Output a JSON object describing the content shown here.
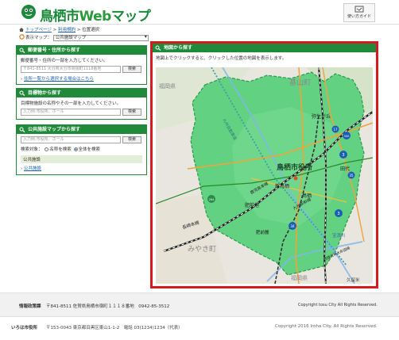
{
  "header": {
    "logo_text_city": "鳥栖市",
    "logo_text_web": "Web",
    "logo_text_map": "マップ",
    "guide_label": "使い方ガイド"
  },
  "breadcrumb": {
    "items": [
      "トップページ",
      "利用規約",
      "位置選択"
    ],
    "separators": [
      ">",
      ">"
    ]
  },
  "display_map": {
    "label": "表示マップ：",
    "selected": "公共施設マップ"
  },
  "panel_postal": {
    "title": "郵便番号・住所から探す",
    "description": "郵便番号・住所の一部を入力してください。",
    "input_placeholder": "〒841-8511 大分県大分市荷揚町1118番地",
    "search_label": "検索",
    "link_text": "住所一覧から選択する場合はこちら"
  },
  "panel_landmark": {
    "title": "目標物から探す",
    "description": "目標物施設の名称やその一部を入力してください。",
    "input_placeholder": "入力例:市役所、ホール",
    "search_label": "検索"
  },
  "panel_facility": {
    "title": "公共施設マップから探す",
    "input_placeholder": "入力例:市役所、ホール",
    "search_label": "検索",
    "target_label": "検索対象：",
    "option_name": "名称を検索",
    "option_all": "全体を検索",
    "category": "公共施設",
    "category_link": "公共施設"
  },
  "map_panel": {
    "title": "地図から探す",
    "note": "地図上でクリックすると、クリックした位置の地図を表示します。",
    "labels": {
      "fukuoka_nw": "福岡県",
      "kiyama": "基山町",
      "city_hall": "鳥栖市役所",
      "shin_tosu": "新鳥栖",
      "tosu": "鳥栖",
      "hizen_asahi": "肥前旭",
      "tashiro": "田代",
      "yayoigaoka": "弥生が丘",
      "nagasaki_line": "長崎本線",
      "kyushu_shinkansen": "九州新幹線",
      "kagoshima_line": "鹿児島本線",
      "miyaki": "みやき町",
      "fukuoka_s": "福岡県",
      "kurume": "久留米",
      "takada": "宝満川",
      "hizenfumoto": "肥前麓",
      "kyushu_expy": "九州自動車道",
      "nishitetsu": "西鉄天神大牟田線"
    },
    "route_numbers": [
      "3",
      "3",
      "34",
      "500",
      "264",
      "17",
      "35"
    ]
  },
  "footer": {
    "info_title": "情報政策課",
    "info_address": "〒841-8511 佐賀県鳥栖市宿町１１１８番地　0942-85-3512",
    "info_copyright": "Copyright tosu City All Rights Reserved.",
    "org": "いろは市役所",
    "org_address": "〒153-0043 東京都目黒区東山1-1-2　電話 03(1234)1234（代表）",
    "org_copyright": "Copyright 2016 Iroha City. All Rights Reserved."
  },
  "colors": {
    "brand_green": "#1e8a3a",
    "highlight_red": "#d71920",
    "city_area": "#5fcf7c",
    "link_blue": "#1a5fb4"
  }
}
